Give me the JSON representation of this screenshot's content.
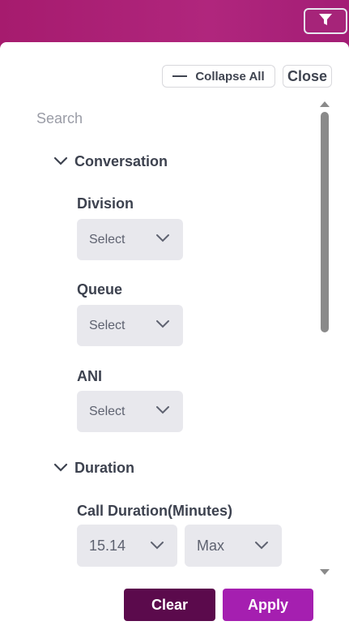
{
  "toolbar": {
    "filter_icon": "filter-icon"
  },
  "panel": {
    "collapse_all_label": "Collapse All",
    "close_label": "Close",
    "search_placeholder": "Search"
  },
  "sections": {
    "conversation": {
      "title": "Conversation",
      "fields": {
        "division": {
          "label": "Division",
          "value": "Select"
        },
        "queue": {
          "label": "Queue",
          "value": "Select"
        },
        "ani": {
          "label": "ANI",
          "value": "Select"
        }
      }
    },
    "duration": {
      "title": "Duration",
      "fields": {
        "call_duration": {
          "label": "Call Duration(Minutes)",
          "min_value": "15.14",
          "max_value": "Max"
        }
      }
    }
  },
  "actions": {
    "clear_label": "Clear",
    "apply_label": "Apply"
  },
  "colors": {
    "header": "#a61b6e",
    "clear": "#5b0a4c",
    "apply": "#a51fb0",
    "select_bg": "#e8e8ed"
  }
}
